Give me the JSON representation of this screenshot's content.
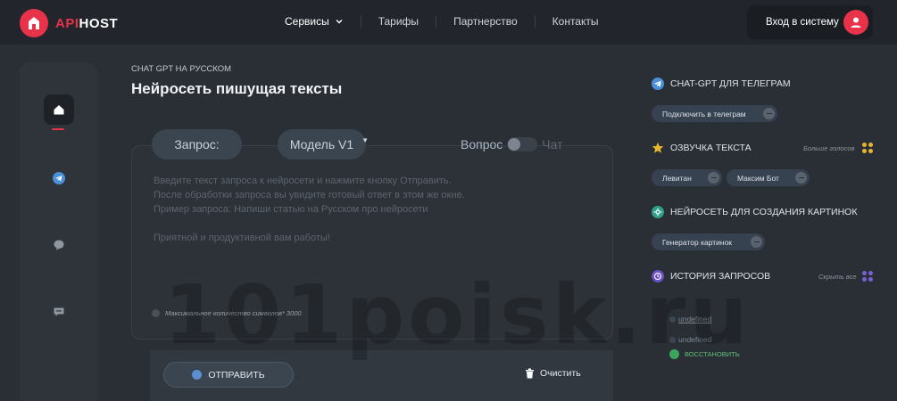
{
  "header": {
    "logo_api": "API",
    "logo_host": "HOST",
    "nav": [
      {
        "label": "Сервисы",
        "active": true
      },
      {
        "label": "Тарифы",
        "active": false
      },
      {
        "label": "Партнерство",
        "active": false
      },
      {
        "label": "Контакты",
        "active": false
      }
    ],
    "login_label": "Вход в систему"
  },
  "page": {
    "subtitle": "CHAT GPT НА РУССКОМ",
    "title": "Нейросеть пишущая тексты"
  },
  "editor": {
    "query_label": "Запрос:",
    "model_label": "Модель V1",
    "mode_question": "Вопрос",
    "mode_chat": "Чат",
    "placeholder_lines": [
      "Введите текст запроса к нейросети и нажмите кнопку Отправить.",
      "После обработки запроса вы увидите готовый ответ в этом же окне.",
      "Пример запроса: Напиши статью на Русском про нейросети",
      "",
      "Приятной и продуктивной вам работы!"
    ],
    "limit_text": "Максимальное количество символов* 3000",
    "send_label": "ОТПРАВИТЬ",
    "clear_label": "Очистить"
  },
  "right_panel": {
    "telegram_title": "CHAT-GPT ДЛЯ ТЕЛЕГРАМ",
    "telegram_chip": "Подключить в телеграм",
    "voice_title": "ОЗВУЧКА ТЕКСТА",
    "voice_more": "Больше голосов",
    "voice_chips": [
      "Левитан",
      "Максим Бот"
    ],
    "images_title": "НЕЙРОСЕТЬ ДЛЯ СОЗДАНИЯ КАРТИНОК",
    "images_chip": "Генератор картинок",
    "history_title": "ИСТОРИЯ ЗАПРОСОВ",
    "history_hide": "Скрыть все",
    "history_items": [
      "undefined",
      "undefined"
    ],
    "restore_label": "ВОССТАНОВИТЬ"
  },
  "watermark": "101poisk.ru",
  "colors": {
    "accent": "#e8324a",
    "background": "#2a2f36",
    "pill": "#3a4550",
    "telegram": "#4a90d9",
    "success": "#3ea35d"
  },
  "icons": {
    "sidebar": [
      "home-icon",
      "telegram-icon",
      "chat-bubble-icon",
      "message-icon"
    ]
  }
}
